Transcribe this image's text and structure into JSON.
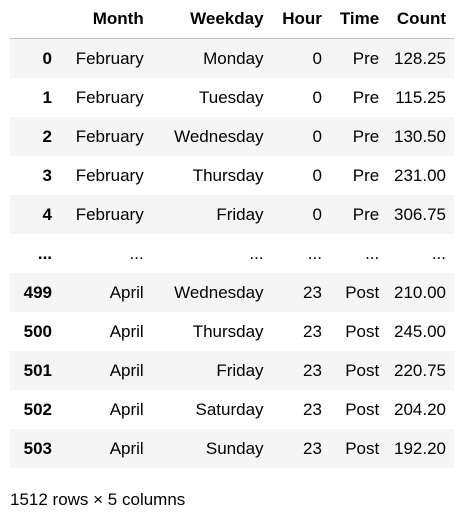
{
  "table": {
    "index_header": "",
    "columns": [
      "Month",
      "Weekday",
      "Hour",
      "Time",
      "Count"
    ],
    "rows": [
      {
        "index": "0",
        "Month": "February",
        "Weekday": "Monday",
        "Hour": "0",
        "Time": "Pre",
        "Count": "128.25"
      },
      {
        "index": "1",
        "Month": "February",
        "Weekday": "Tuesday",
        "Hour": "0",
        "Time": "Pre",
        "Count": "115.25"
      },
      {
        "index": "2",
        "Month": "February",
        "Weekday": "Wednesday",
        "Hour": "0",
        "Time": "Pre",
        "Count": "130.50"
      },
      {
        "index": "3",
        "Month": "February",
        "Weekday": "Thursday",
        "Hour": "0",
        "Time": "Pre",
        "Count": "231.00"
      },
      {
        "index": "4",
        "Month": "February",
        "Weekday": "Friday",
        "Hour": "0",
        "Time": "Pre",
        "Count": "306.75"
      },
      {
        "index": "...",
        "Month": "...",
        "Weekday": "...",
        "Hour": "...",
        "Time": "...",
        "Count": "..."
      },
      {
        "index": "499",
        "Month": "April",
        "Weekday": "Wednesday",
        "Hour": "23",
        "Time": "Post",
        "Count": "210.00"
      },
      {
        "index": "500",
        "Month": "April",
        "Weekday": "Thursday",
        "Hour": "23",
        "Time": "Post",
        "Count": "245.00"
      },
      {
        "index": "501",
        "Month": "April",
        "Weekday": "Friday",
        "Hour": "23",
        "Time": "Post",
        "Count": "220.75"
      },
      {
        "index": "502",
        "Month": "April",
        "Weekday": "Saturday",
        "Hour": "23",
        "Time": "Post",
        "Count": "204.20"
      },
      {
        "index": "503",
        "Month": "April",
        "Weekday": "Sunday",
        "Hour": "23",
        "Time": "Post",
        "Count": "192.20"
      }
    ]
  },
  "shape_info": "1512 rows × 5 columns"
}
